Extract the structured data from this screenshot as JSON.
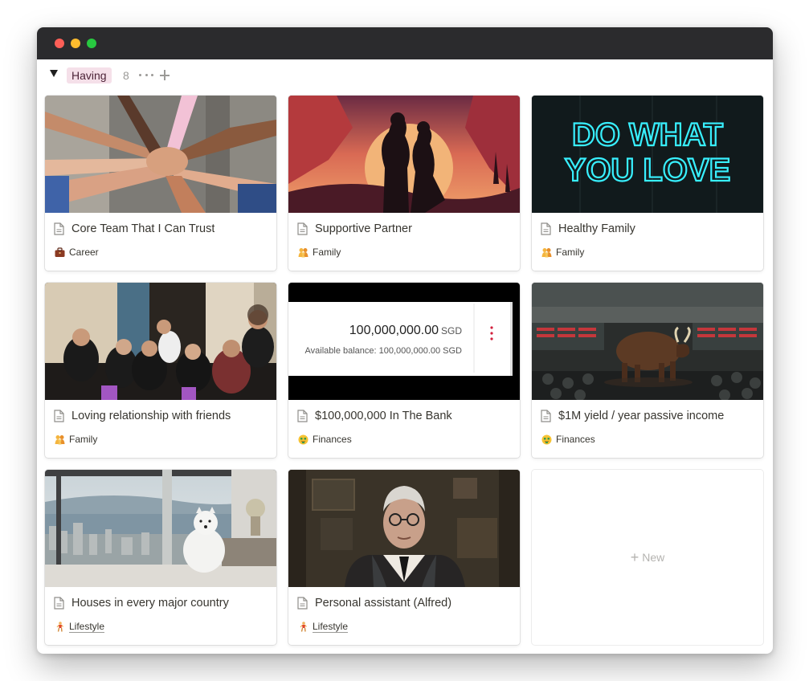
{
  "group": {
    "tag": "Having",
    "count": "8"
  },
  "cards": [
    {
      "title": "Core Team That I Can Trust",
      "tag": "Career",
      "tag_icon": "briefcase-emoji",
      "cover": "team-hands-photo"
    },
    {
      "title": "Supportive Partner",
      "tag": "Family",
      "tag_icon": "family-emoji",
      "cover": "couple-sunset-illustration"
    },
    {
      "title": "Healthy Family",
      "tag": "Family",
      "tag_icon": "family-emoji",
      "cover": "do-what-you-love-neon",
      "cover_text_line1": "DO WHAT",
      "cover_text_line2": "YOU LOVE"
    },
    {
      "title": "Loving relationship with friends",
      "tag": "Family",
      "tag_icon": "family-emoji",
      "cover": "friends-group-photo"
    },
    {
      "title": "$100,000,000 In The Bank",
      "tag": "Finances",
      "tag_icon": "money-face-emoji",
      "cover": "bank-balance-screenshot",
      "balance_amount": "100,000,000.00",
      "balance_currency": "SGD",
      "balance_caption": "Available balance: 100,000,000.00 SGD"
    },
    {
      "title": "$1M yield / year passive income",
      "tag": "Finances",
      "tag_icon": "money-face-emoji",
      "cover": "bull-trading-floor"
    },
    {
      "title": "Houses in every major country",
      "tag": "Lifestyle",
      "tag_icon": "person-emoji",
      "cover": "dog-penthouse-view"
    },
    {
      "title": "Personal assistant (Alfred)",
      "tag": "Lifestyle",
      "tag_icon": "person-emoji",
      "cover": "butler-portrait"
    }
  ],
  "new_card": {
    "label": "New"
  },
  "colors": {
    "titlebar": "#2b2b2d",
    "group_tag_bg": "#f5e0e9",
    "neon": "#38f0ff"
  }
}
